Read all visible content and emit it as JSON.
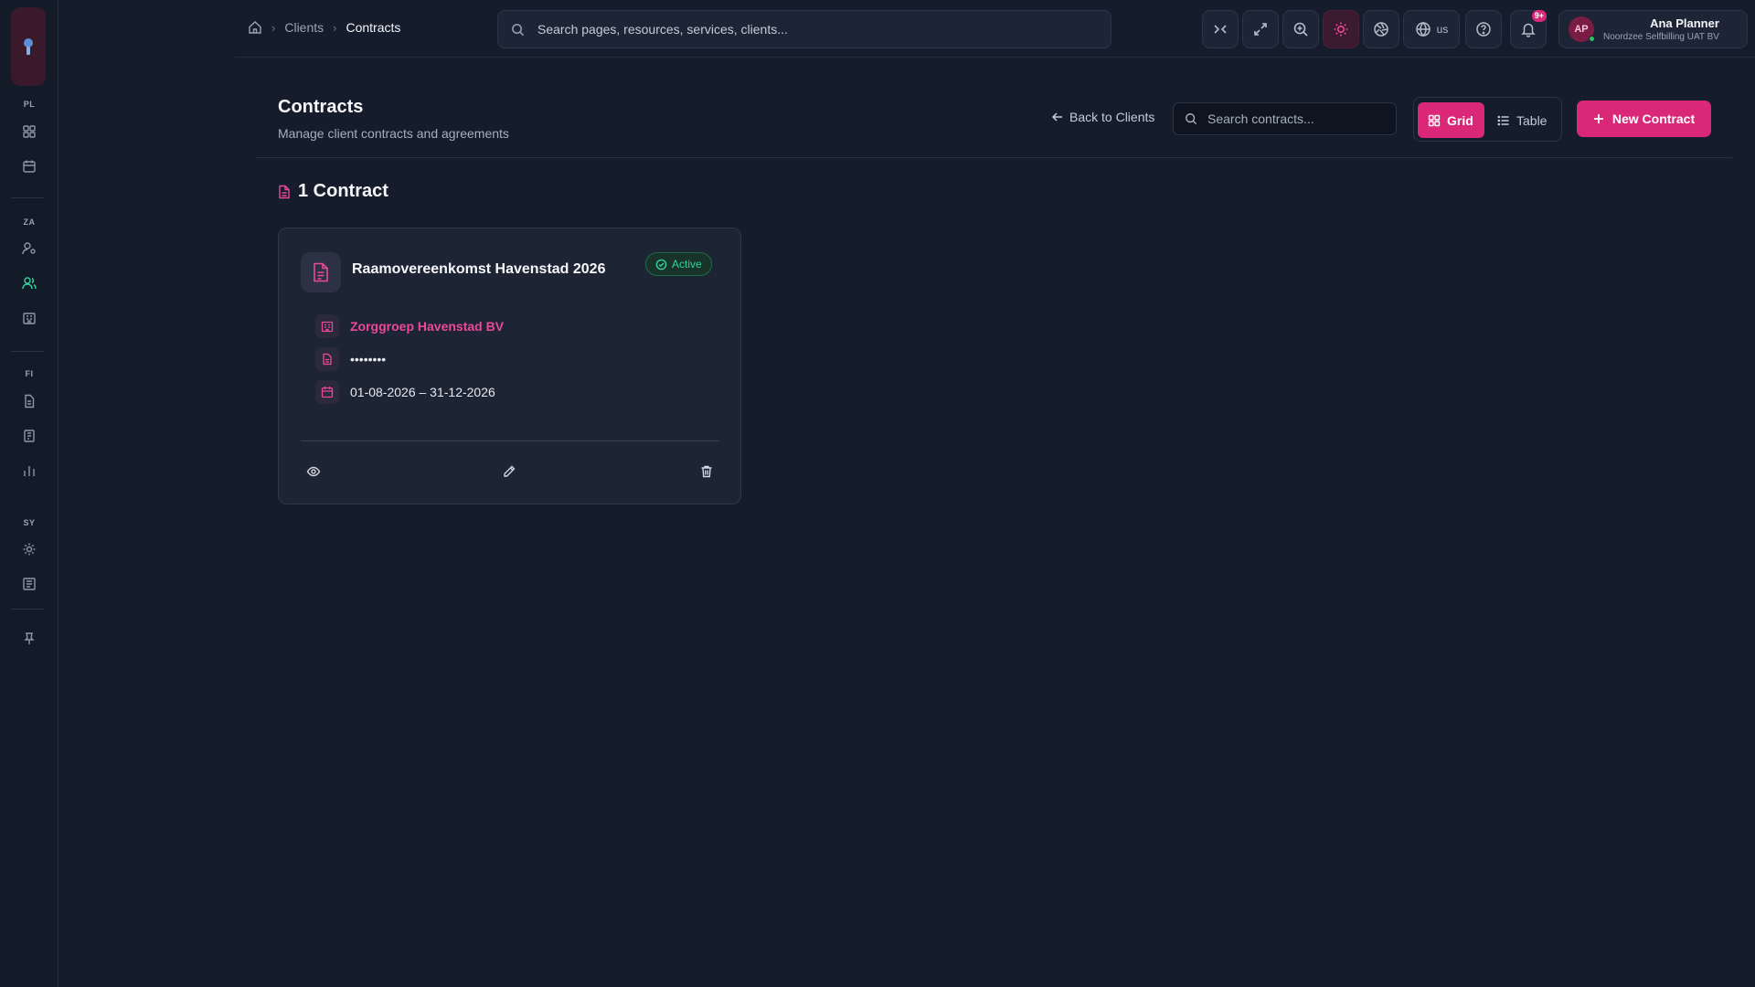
{
  "sidebar": {
    "sections": [
      {
        "label": "PL"
      },
      {
        "label": "ZA"
      },
      {
        "label": "FI"
      },
      {
        "label": "SY"
      }
    ]
  },
  "breadcrumb": {
    "items": [
      "Clients",
      "Contracts"
    ]
  },
  "topbar": {
    "search_placeholder": "Search pages, resources, services, clients...",
    "language": "us",
    "notification_count": "9+",
    "user": {
      "initials": "AP",
      "name": "Ana Planner",
      "org": "Noordzee Selfbilling UAT BV"
    }
  },
  "page": {
    "title": "Contracts",
    "subtitle": "Manage client contracts and agreements",
    "back_label": "Back to Clients",
    "search_placeholder": "Search contracts...",
    "view_grid_label": "Grid",
    "view_table_label": "Table",
    "new_button_label": "New Contract",
    "count_label": "1 Contract"
  },
  "contracts": [
    {
      "title": "Raamovereenkomst Havenstad 2026",
      "status": "Active",
      "client": "Zorggroep Havenstad BV",
      "reference": "••••••••",
      "period": "01-08-2026 – 31-12-2026"
    }
  ],
  "colors": {
    "accent": "#db2777",
    "accent_text": "#ec4899",
    "status_active": "#34d399",
    "background": "#151c2c",
    "card": "#1d2535"
  }
}
